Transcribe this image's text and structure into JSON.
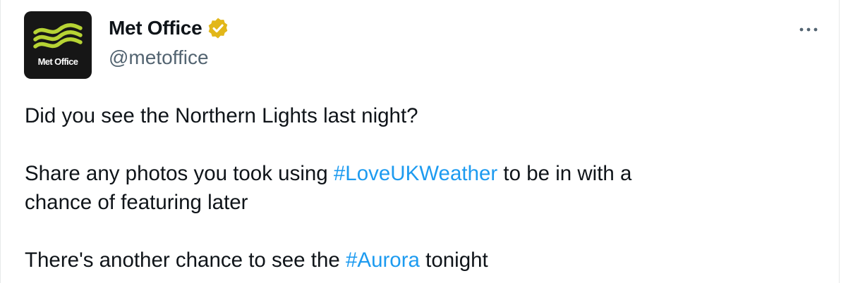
{
  "author": {
    "display_name": "Met Office",
    "handle": "@metoffice",
    "avatar_text": "Met Office",
    "verified": true,
    "verified_color": "#e2b719"
  },
  "menu": {
    "icon": "more-horizontal-icon"
  },
  "tweet": {
    "line1": "Did you see the Northern Lights last night?",
    "line2_pre": "Share any photos you took using ",
    "line2_hashtag": "#LoveUKWeather",
    "line2_post": " to be in with a",
    "line3": "chance of featuring later",
    "line4_pre": "There's another chance to see the ",
    "line4_hashtag": "#Aurora",
    "line4_post": " tonight"
  },
  "colors": {
    "text": "#0f1419",
    "secondary": "#536471",
    "link": "#1d9bf0",
    "avatar_bg": "#161616",
    "avatar_waves": "#b6d334"
  }
}
